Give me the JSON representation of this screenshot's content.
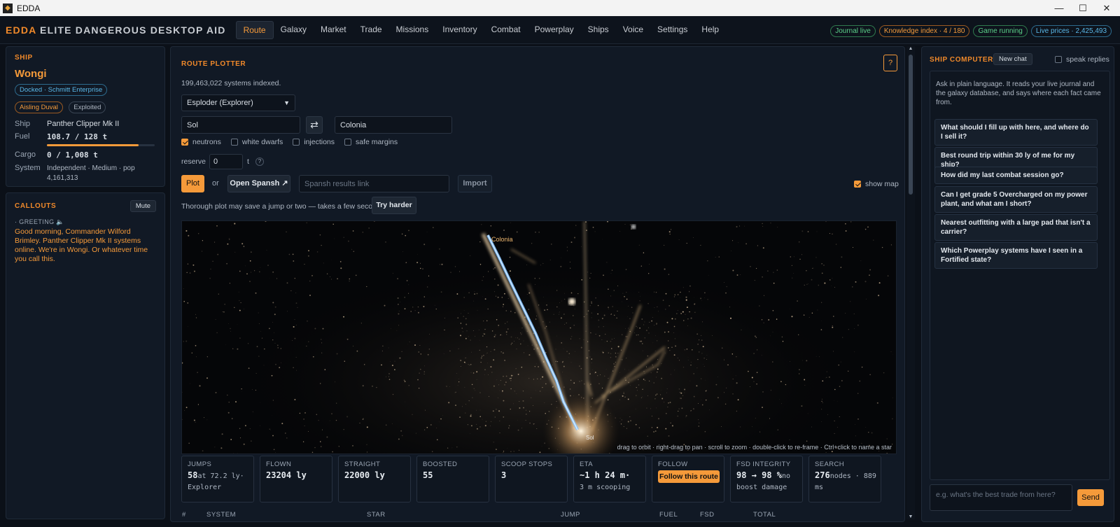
{
  "window": {
    "title": "EDDA",
    "app_icon": "edda-logo-icon",
    "minimize": "—",
    "maximize": "☐",
    "close": "✕"
  },
  "brand": {
    "part1": "EDDA",
    "part2": "ELITE DANGEROUS DESKTOP AID"
  },
  "nav": {
    "tabs": [
      "Route",
      "Galaxy",
      "Market",
      "Trade",
      "Missions",
      "Inventory",
      "Combat",
      "Powerplay",
      "Ships",
      "Voice",
      "Settings",
      "Help"
    ],
    "active": "Route"
  },
  "status_pills": [
    {
      "label": "Journal live",
      "color": "green"
    },
    {
      "label": "Knowledge index · 4 / 180",
      "color": "orange"
    },
    {
      "label": "Game running",
      "color": "green"
    },
    {
      "label": "Live prices · 2,425,493",
      "color": "blue"
    }
  ],
  "ship": {
    "heading": "SHIP",
    "name": "Wongi",
    "docked_badge": "Docked · Schmitt Enterprise",
    "power_badge": "Aisling Duval",
    "state_badge": "Exploited",
    "rows": {
      "ship_label": "Ship",
      "ship_value": "Panther Clipper Mk II",
      "fuel_label": "Fuel",
      "fuel_value": "108.7 / 128 t",
      "fuel_fraction": 0.849,
      "cargo_label": "Cargo",
      "cargo_value": "0 / 1,008 t",
      "system_label": "System",
      "system_value1": "Independent · Medium · pop",
      "system_value2": "4,161,313"
    }
  },
  "callouts": {
    "heading": "CALLOUTS",
    "mute_label": "Mute",
    "greeting_label": "· GREETING",
    "speaker_icon": "speaker-icon",
    "message": "Good morning, Commander Wilford Brimley. Panther Clipper Mk II systems online. We're in Wongi. Or whatever time you call this."
  },
  "route": {
    "heading": "ROUTE PLOTTER",
    "help_label": "?",
    "indexed": "199,463,022 systems indexed.",
    "ship_select": "Esploder (Explorer)",
    "from": "Sol",
    "swap_icon": "swap-arrows-icon",
    "to": "Colonia",
    "options": [
      {
        "label": "neutrons",
        "checked": true
      },
      {
        "label": "white dwarfs",
        "checked": false
      },
      {
        "label": "injections",
        "checked": false
      },
      {
        "label": "safe margins",
        "checked": false
      }
    ],
    "reserve_label": "reserve",
    "reserve_value": "0",
    "reserve_unit": "t",
    "reserve_help": "?",
    "plot_label": "Plot",
    "or_label": "or",
    "spansh_label": "Open Spansh ↗",
    "spansh_placeholder": "Spansh results link",
    "import_label": "Import",
    "show_map_label": "show map",
    "show_map_checked": true,
    "thorough_note": "Thorough plot may save a jump or two — takes a few seconds.",
    "try_harder_label": "Try harder",
    "map_label_colonia": "Colonia",
    "map_label_sol": "Sol",
    "map_hint": "drag to orbit · right-drag to pan · scroll to zoom · double-click to re-frame · Ctrl+click to name a star"
  },
  "stats": {
    "jumps": {
      "label": "JUMPS",
      "value": "58",
      "unit": "at 72.2 ly·",
      "sub": "Explorer"
    },
    "flown": {
      "label": "FLOWN",
      "value": "23204 ly"
    },
    "straight": {
      "label": "STRAIGHT",
      "value": "22000 ly"
    },
    "boosted": {
      "label": "BOOSTED",
      "value": "55"
    },
    "scoop": {
      "label": "SCOOP STOPS",
      "value": "3"
    },
    "eta": {
      "label": "ETA",
      "value": "~1 h 24 m·",
      "sub": "3 m scooping"
    },
    "follow": {
      "label": "FOLLOW",
      "button": "Follow this route"
    },
    "fsd": {
      "label": "FSD INTEGRITY",
      "value": "98 → 98 %",
      "unit": "no",
      "sub": "boost damage"
    },
    "search": {
      "label": "SEARCH",
      "value": "276",
      "unit": "nodes · 889",
      "sub": "ms"
    }
  },
  "table_headers": [
    "#",
    "SYSTEM",
    "STAR",
    "JUMP",
    "FUEL",
    "FSD",
    "TOTAL"
  ],
  "computer": {
    "heading": "SHIP COMPUTER",
    "new_chat": "New chat",
    "speak_label": "speak replies",
    "speak_checked": false,
    "intro": "Ask in plain language. It reads your live journal and the galaxy database, and says where each fact came from.",
    "suggestions": [
      "What should I fill up with here, and where do I sell it?",
      "Best round trip within 30 ly of me for my ship?",
      "How did my last combat session go?",
      "Can I get grade 5 Overcharged on my power plant, and what am I short?",
      "Nearest outfitting with a large pad that isn't a carrier?",
      "Which Powerplay systems have I seen in a Fortified state?"
    ],
    "input_placeholder": "e.g. what's the best trade from here?",
    "send_label": "Send"
  },
  "colors": {
    "accent": "#f59a3a",
    "brand": "#f0892a",
    "route_line": "#8cc8ff",
    "background": "#0b1018"
  }
}
